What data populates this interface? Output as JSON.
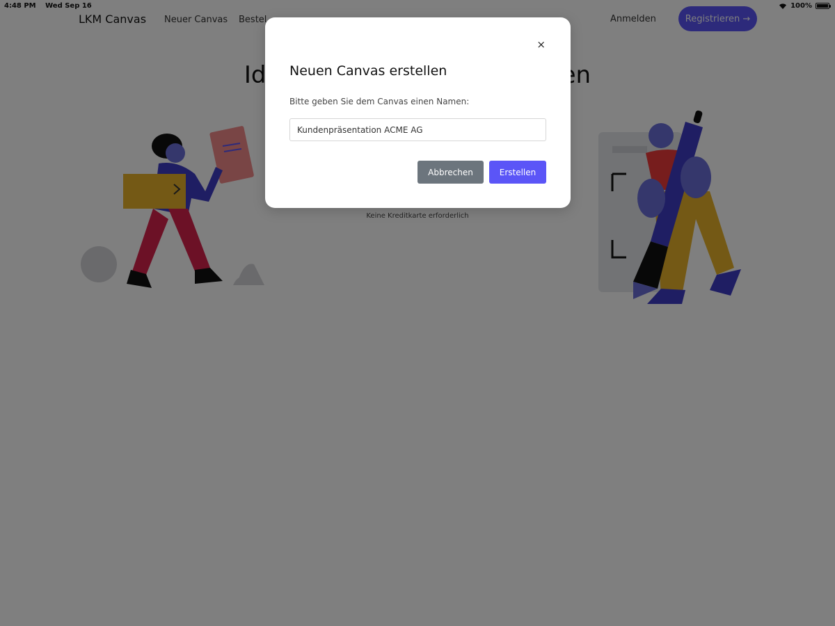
{
  "status_bar": {
    "time": "4:48 PM",
    "date": "Wed Sep 16",
    "battery": "100%"
  },
  "nav": {
    "brand": "LKM Canvas",
    "links": [
      "Neuer Canvas",
      "Bestel"
    ],
    "signin": "Anmelden",
    "register": "Registrieren →"
  },
  "hero": {
    "title_left": "Ide",
    "title_right": "ren",
    "note": "Keine Kreditkarte erforderlich"
  },
  "dialog": {
    "close": "×",
    "title": "Neuen Canvas erstellen",
    "prompt": "Bitte geben Sie dem Canvas einen Namen:",
    "input_value": "Kundenpräsentation ACME AG",
    "cancel": "Abbrechen",
    "create": "Erstellen"
  },
  "colors": {
    "accent": "#5b55f7",
    "cancel": "#6c757d",
    "overlay": "rgba(0,0,0,0.5)"
  }
}
